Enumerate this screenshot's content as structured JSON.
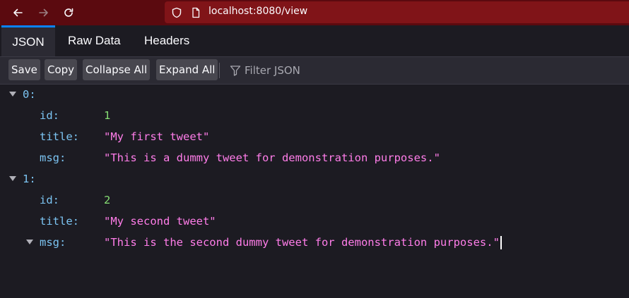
{
  "browser": {
    "url": "localhost:8080/view",
    "back_icon": "arrow-left-icon",
    "forward_icon": "arrow-right-icon",
    "reload_icon": "reload-icon",
    "shield_icon": "shield-icon",
    "page_icon": "page-icon"
  },
  "tabs": [
    {
      "label": "JSON",
      "active": true
    },
    {
      "label": "Raw Data",
      "active": false
    },
    {
      "label": "Headers",
      "active": false
    }
  ],
  "toolbar": {
    "save_label": "Save",
    "copy_label": "Copy",
    "collapse_label": "Collapse All",
    "expand_label": "Expand All",
    "filter_placeholder": "Filter JSON",
    "filter_icon": "filter-icon"
  },
  "tree": [
    {
      "index": "0:",
      "id_key": "id:",
      "id_value": "1",
      "title_key": "title:",
      "title_value": "\"My first tweet\"",
      "msg_key": "msg:",
      "msg_value": "\"This is a dummy tweet for demonstration purposes.\""
    },
    {
      "index": "1:",
      "id_key": "id:",
      "id_value": "2",
      "title_key": "title:",
      "title_value": "\"My second tweet\"",
      "msg_key": "msg:",
      "msg_value": "\"This is the second dummy tweet for demonstration purposes.\""
    }
  ],
  "colors": {
    "browser_bar": "#5b0a0f",
    "urlbar": "#801418",
    "background": "#1c1b22",
    "toolbar": "#2b2a33",
    "tab_accent": "#0a84ff",
    "key": "#7cc4f2",
    "number": "#86de74",
    "string": "#ff7de9"
  }
}
